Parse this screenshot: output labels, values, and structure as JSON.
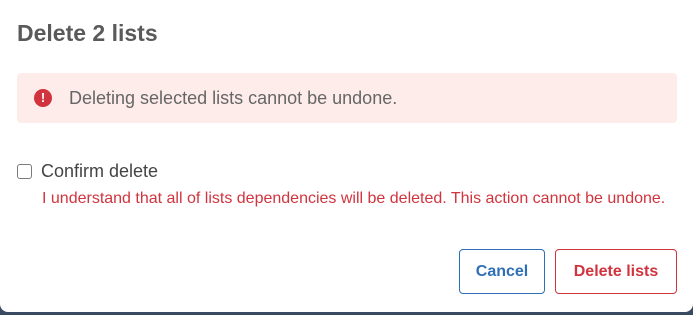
{
  "dialog": {
    "title": "Delete 2 lists",
    "alert": {
      "icon": "exclamation-circle-icon",
      "text": "Deleting selected lists cannot be undone.",
      "color": "#d1343e",
      "background": "#fdecea"
    },
    "confirm": {
      "label": "Confirm delete",
      "checked": false,
      "warning": "I understand that all of lists dependencies will be deleted. This action cannot be undone."
    },
    "buttons": {
      "cancel_label": "Cancel",
      "delete_label": "Delete lists"
    },
    "colors": {
      "primary": "#2f6fb5",
      "danger": "#d1343e"
    }
  }
}
